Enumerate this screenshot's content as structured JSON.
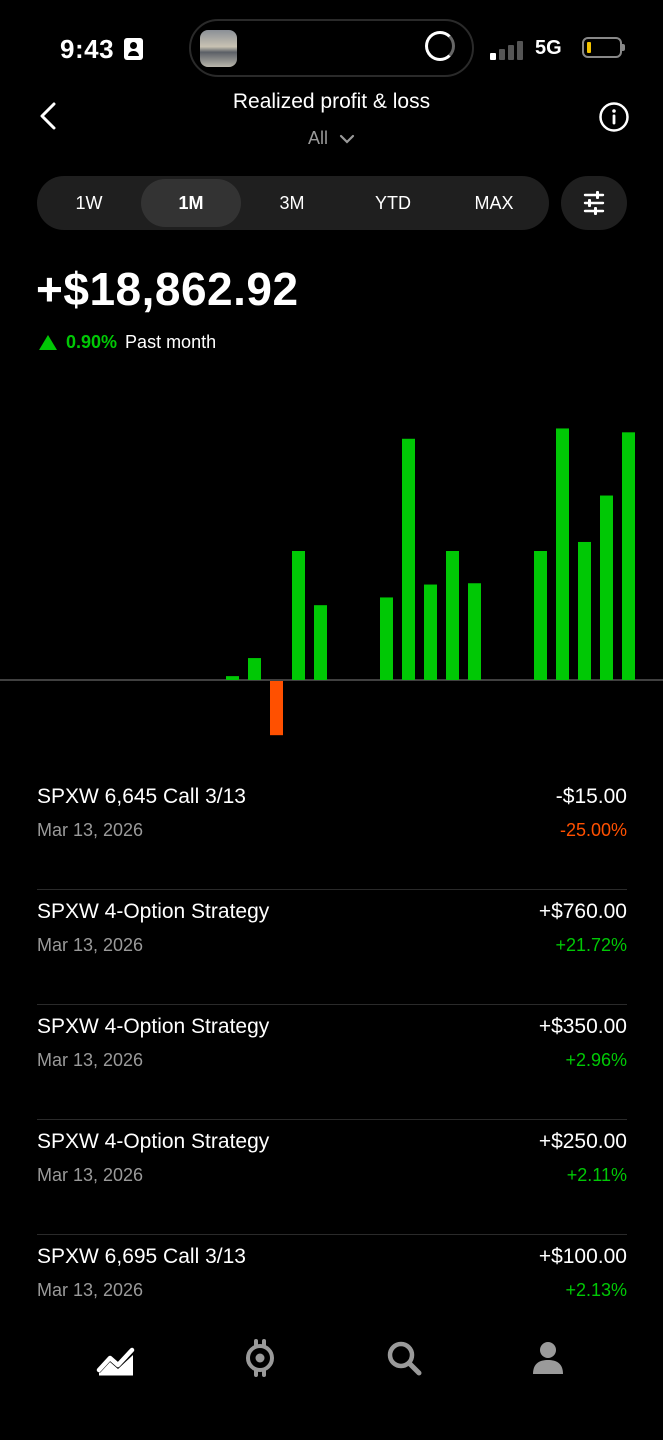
{
  "status_bar": {
    "time": "9:43",
    "network": "5G"
  },
  "header": {
    "title": "Realized profit & loss",
    "filter_label": "All"
  },
  "ranges": [
    "1W",
    "1M",
    "3M",
    "YTD",
    "MAX"
  ],
  "active_range": "1M",
  "summary": {
    "value": "+$18,862.92",
    "change_pct": "0.90%",
    "period": "Past month"
  },
  "colors": {
    "positive": "#00c805",
    "negative": "#ff5000",
    "background": "#000000"
  },
  "chart_data": {
    "type": "bar",
    "values": [
      0.3,
      1.7,
      -4.2,
      10,
      5.8,
      0,
      0,
      6.4,
      18.7,
      7.4,
      10,
      7.5,
      0,
      0,
      10,
      19.5,
      10.7,
      14.3,
      19.2
    ],
    "ylim": [
      -6,
      20
    ],
    "grid": false
  },
  "transactions": [
    {
      "name": "SPXW 6,645 Call 3/13",
      "date": "Mar 13, 2026",
      "amount": "-$15.00",
      "pct": "-25.00%",
      "direction": "neg"
    },
    {
      "name": "SPXW 4-Option Strategy",
      "date": "Mar 13, 2026",
      "amount": "+$760.00",
      "pct": "+21.72%",
      "direction": "pos"
    },
    {
      "name": "SPXW 4-Option Strategy",
      "date": "Mar 13, 2026",
      "amount": "+$350.00",
      "pct": "+2.96%",
      "direction": "pos"
    },
    {
      "name": "SPXW 4-Option Strategy",
      "date": "Mar 13, 2026",
      "amount": "+$250.00",
      "pct": "+2.11%",
      "direction": "pos"
    },
    {
      "name": "SPXW 6,695 Call 3/13",
      "date": "Mar 13, 2026",
      "amount": "+$100.00",
      "pct": "+2.13%",
      "direction": "pos"
    }
  ],
  "nav": [
    {
      "icon": "chart-icon",
      "active": true
    },
    {
      "icon": "crypto-icon",
      "active": false
    },
    {
      "icon": "search-icon",
      "active": false
    },
    {
      "icon": "account-icon",
      "active": false
    }
  ]
}
